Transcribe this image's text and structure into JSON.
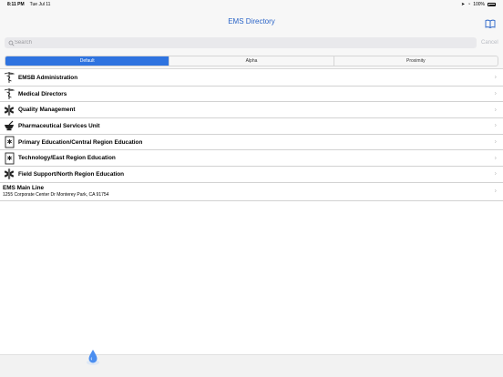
{
  "status": {
    "time": "8:11 PM",
    "date": "Tue Jul 11",
    "battery": "100%"
  },
  "nav": {
    "title": "EMS Directory",
    "book_icon": "book-icon"
  },
  "search": {
    "placeholder": "Search",
    "cancel": "Cancel"
  },
  "segments": [
    {
      "label": "Default",
      "selected": true
    },
    {
      "label": "Alpha",
      "selected": false
    },
    {
      "label": "Proximity",
      "selected": false
    }
  ],
  "rows": [
    {
      "label": "EMSB Administration",
      "icon": "caduceus-icon"
    },
    {
      "label": "Medical Directors",
      "icon": "caduceus-icon"
    },
    {
      "label": "Quality Management",
      "icon": "star-of-life-icon"
    },
    {
      "label": "Pharmaceutical Services Unit",
      "icon": "mortar-pestle-icon"
    },
    {
      "label": "Primary Education/Central Region Education",
      "icon": "handbook-icon"
    },
    {
      "label": "Technology/East Region Education",
      "icon": "handbook-icon"
    },
    {
      "label": "Field Support/North Region Education",
      "icon": "star-of-life-icon"
    }
  ],
  "main_line": {
    "title": "EMS Main Line",
    "address": "1255 Corporate Center Dr Monterey Park, CA 91754"
  },
  "colors": {
    "accent": "#2e73e0",
    "title": "#2a64c7"
  }
}
